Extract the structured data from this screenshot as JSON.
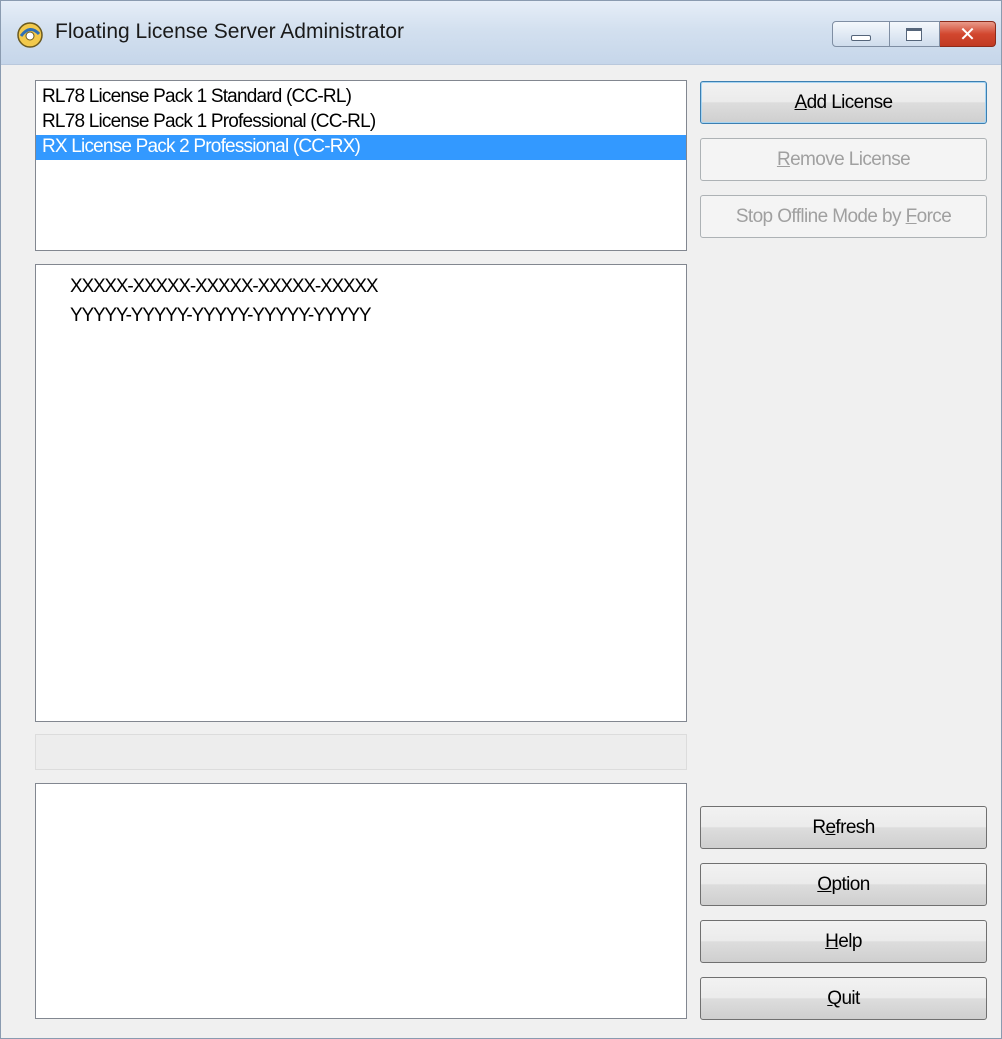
{
  "window": {
    "title": "Floating License Server Administrator",
    "icon": "license-server-app-icon",
    "controls": {
      "minimize_icon": "minimize-icon",
      "maximize_icon": "maximize-icon",
      "close_icon": "close-icon",
      "close_glyph": "✕"
    }
  },
  "licenses": {
    "items": [
      {
        "label": "RL78 License Pack 1 Standard (CC-RL)",
        "selected": false
      },
      {
        "label": "RL78 License Pack 1 Professional (CC-RL)",
        "selected": false
      },
      {
        "label": "RX License Pack 2 Professional (CC-RX)",
        "selected": true
      }
    ]
  },
  "keys": {
    "items": [
      "XXXXX-XXXXX-XXXXX-XXXXX-XXXXX",
      "YYYYY-YYYYY-YYYYY-YYYYY-YYYYY"
    ]
  },
  "buttons": {
    "add_license": {
      "pre": "",
      "mnemonic": "A",
      "post": "dd License",
      "enabled": true
    },
    "remove_license": {
      "pre": "",
      "mnemonic": "R",
      "post": "emove License",
      "enabled": false
    },
    "stop_offline": {
      "pre": "Stop Offline Mode by ",
      "mnemonic": "F",
      "post": "orce",
      "enabled": false
    },
    "refresh": {
      "pre": "R",
      "mnemonic": "e",
      "post": "fresh",
      "enabled": true
    },
    "option": {
      "pre": "",
      "mnemonic": "O",
      "post": "ption",
      "enabled": true
    },
    "help": {
      "pre": "",
      "mnemonic": "H",
      "post": "elp",
      "enabled": true
    },
    "quit": {
      "pre": "",
      "mnemonic": "Q",
      "post": "uit",
      "enabled": true
    }
  },
  "colors": {
    "selection": "#3399ff",
    "disabled_text": "#a0a0a0"
  }
}
